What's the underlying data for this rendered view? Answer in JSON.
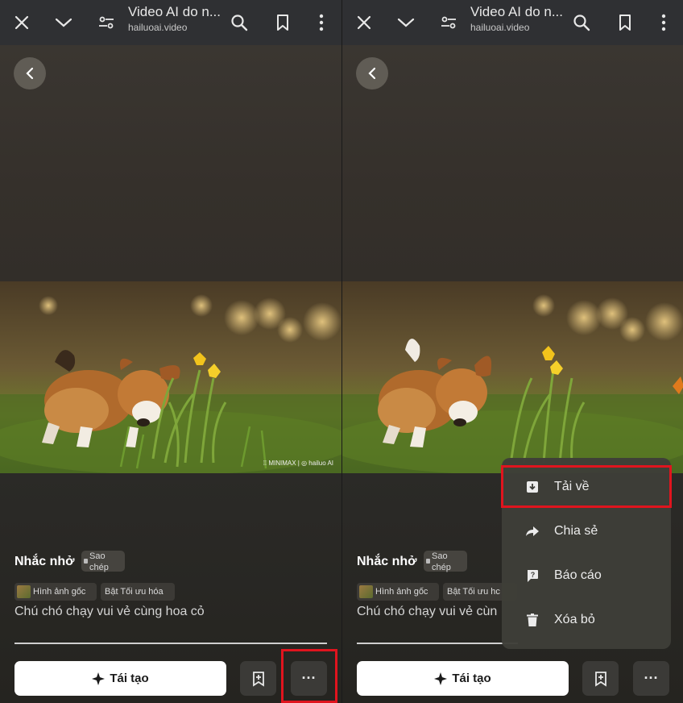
{
  "browser": {
    "page_title": "Video AI do n...",
    "domain": "hailuoai.video",
    "icons": [
      "close-icon",
      "chevron-down-icon",
      "page-settings-icon",
      "search-icon",
      "bookmark-icon",
      "more-vert-icon"
    ]
  },
  "video": {
    "watermark": "⁞⁞ MINIMAX | ◎ hailuo AI",
    "title": "Nhắc nhở",
    "copy_label": "Sao chép",
    "original_image_label": "Hình ảnh gốc",
    "optimize_label": "Bật Tối ưu hóa",
    "optimize_label_truncated": "Bật Tối ưu hc",
    "prompt": "Chú chó chạy vui vẻ cùng hoa cỏ",
    "prompt_truncated": "Chú chó chạy vui vẻ cùn"
  },
  "actions": {
    "regenerate_label": "Tái tạo",
    "more_label": "···"
  },
  "menu": {
    "items": [
      {
        "label": "Tải về",
        "icon": "download-icon"
      },
      {
        "label": "Chia sẻ",
        "icon": "share-icon"
      },
      {
        "label": "Báo cáo",
        "icon": "report-icon"
      },
      {
        "label": "Xóa bỏ",
        "icon": "delete-icon"
      }
    ]
  },
  "colors": {
    "highlight": "#e0141e",
    "toolbar": "#2f3033",
    "background": "#2e2b27"
  }
}
